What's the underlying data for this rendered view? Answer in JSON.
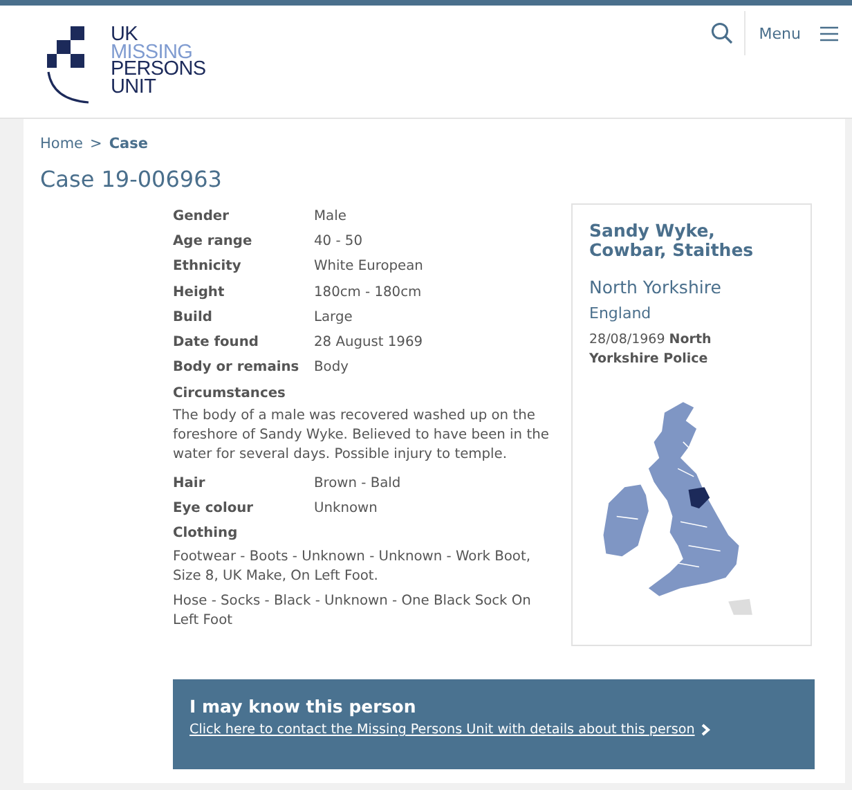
{
  "logo": {
    "lines": [
      {
        "text": "UK",
        "kind": "dark"
      },
      {
        "text": "MISSING",
        "kind": "light"
      },
      {
        "text": "PERSONS",
        "kind": "dark"
      },
      {
        "text": "UNIT",
        "kind": "dark"
      }
    ]
  },
  "header": {
    "menu_label": "Menu"
  },
  "breadcrumb": {
    "items": [
      {
        "text": "Home",
        "kind": "link"
      },
      {
        "text": ">",
        "kind": "separator"
      },
      {
        "text": "Case",
        "kind": "current"
      }
    ]
  },
  "title": "Case 19-006963",
  "details": [
    {
      "kind": "pair",
      "label": "Gender",
      "value": "Male"
    },
    {
      "kind": "pair",
      "label": "Age range",
      "value": "40 - 50"
    },
    {
      "kind": "pair",
      "label": "Ethnicity",
      "value": "White European"
    },
    {
      "kind": "pair",
      "label": "Height",
      "value": "180cm - 180cm"
    },
    {
      "kind": "pair",
      "label": "Build",
      "value": "Large"
    },
    {
      "kind": "pair",
      "label": "Date found",
      "value": "28 August 1969"
    },
    {
      "kind": "pair",
      "label": "Body or remains",
      "value": "Body"
    },
    {
      "kind": "block",
      "label": "Circumstances",
      "paragraphs": [
        "The body of a male was recovered washed up on the foreshore of Sandy Wyke. Believed to have been in the water for several days. Possible injury to temple."
      ]
    },
    {
      "kind": "pair",
      "label": "Hair",
      "value": "Brown - Bald"
    },
    {
      "kind": "pair",
      "label": "Eye colour",
      "value": "Unknown"
    },
    {
      "kind": "block",
      "label": "Clothing",
      "paragraphs": [
        "Footwear - Boots - Unknown - Unknown - Work Boot, Size 8, UK Make, On Left Foot.",
        "Hose - Socks - Black - Unknown - One Black Sock On Left Foot"
      ]
    }
  ],
  "location": {
    "place": "Sandy Wyke, Cowbar, Staithes",
    "county": "North Yorkshire",
    "country": "England",
    "date": "28/08/1969",
    "force": "North Yorkshire Police"
  },
  "contact": {
    "heading": "I may know this person",
    "link": "Click here to contact the Missing Persons Unit with details about this person"
  }
}
